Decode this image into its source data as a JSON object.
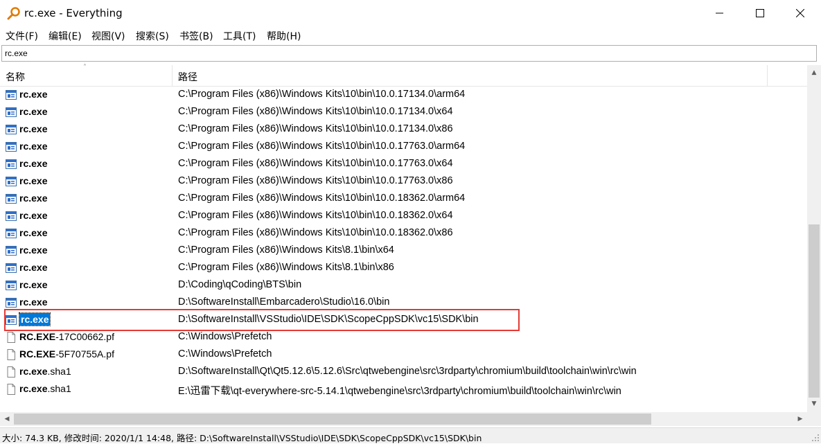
{
  "window": {
    "title": "rc.exe - Everything"
  },
  "menu": [
    {
      "id": "file",
      "label": "文件(F)"
    },
    {
      "id": "edit",
      "label": "编辑(E)"
    },
    {
      "id": "view",
      "label": "视图(V)"
    },
    {
      "id": "search",
      "label": "搜索(S)"
    },
    {
      "id": "bookmarks",
      "label": "书签(B)"
    },
    {
      "id": "tools",
      "label": "工具(T)"
    },
    {
      "id": "help",
      "label": "帮助(H)"
    }
  ],
  "search": {
    "value": "rc.exe"
  },
  "columns": {
    "name": "名称",
    "path": "路径"
  },
  "icons": {
    "exe": "executable-icon",
    "file": "file-icon"
  },
  "rows": [
    {
      "icon": "exe",
      "bold": "rc.exe",
      "rest": "",
      "path": "C:\\Program Files (x86)\\Windows Kits\\10\\bin\\10.0.17134.0\\arm64"
    },
    {
      "icon": "exe",
      "bold": "rc.exe",
      "rest": "",
      "path": "C:\\Program Files (x86)\\Windows Kits\\10\\bin\\10.0.17134.0\\x64"
    },
    {
      "icon": "exe",
      "bold": "rc.exe",
      "rest": "",
      "path": "C:\\Program Files (x86)\\Windows Kits\\10\\bin\\10.0.17134.0\\x86"
    },
    {
      "icon": "exe",
      "bold": "rc.exe",
      "rest": "",
      "path": "C:\\Program Files (x86)\\Windows Kits\\10\\bin\\10.0.17763.0\\arm64"
    },
    {
      "icon": "exe",
      "bold": "rc.exe",
      "rest": "",
      "path": "C:\\Program Files (x86)\\Windows Kits\\10\\bin\\10.0.17763.0\\x64"
    },
    {
      "icon": "exe",
      "bold": "rc.exe",
      "rest": "",
      "path": "C:\\Program Files (x86)\\Windows Kits\\10\\bin\\10.0.17763.0\\x86"
    },
    {
      "icon": "exe",
      "bold": "rc.exe",
      "rest": "",
      "path": "C:\\Program Files (x86)\\Windows Kits\\10\\bin\\10.0.18362.0\\arm64"
    },
    {
      "icon": "exe",
      "bold": "rc.exe",
      "rest": "",
      "path": "C:\\Program Files (x86)\\Windows Kits\\10\\bin\\10.0.18362.0\\x64"
    },
    {
      "icon": "exe",
      "bold": "rc.exe",
      "rest": "",
      "path": "C:\\Program Files (x86)\\Windows Kits\\10\\bin\\10.0.18362.0\\x86"
    },
    {
      "icon": "exe",
      "bold": "rc.exe",
      "rest": "",
      "path": "C:\\Program Files (x86)\\Windows Kits\\8.1\\bin\\x64"
    },
    {
      "icon": "exe",
      "bold": "rc.exe",
      "rest": "",
      "path": "C:\\Program Files (x86)\\Windows Kits\\8.1\\bin\\x86"
    },
    {
      "icon": "exe",
      "bold": "rc.exe",
      "rest": "",
      "path": "D:\\Coding\\qCoding\\BTS\\bin"
    },
    {
      "icon": "exe",
      "bold": "rc.exe",
      "rest": "",
      "path": "D:\\SoftwareInstall\\Embarcadero\\Studio\\16.0\\bin"
    },
    {
      "icon": "exe",
      "bold": "rc.exe",
      "rest": "",
      "path": "D:\\SoftwareInstall\\VSStudio\\IDE\\SDK\\ScopeCppSDK\\vc15\\SDK\\bin",
      "selected": true
    },
    {
      "icon": "file",
      "bold": "RC.EXE",
      "rest": "-17C00662.pf",
      "path": "C:\\Windows\\Prefetch"
    },
    {
      "icon": "file",
      "bold": "RC.EXE",
      "rest": "-5F70755A.pf",
      "path": "C:\\Windows\\Prefetch"
    },
    {
      "icon": "file",
      "bold": "rc.exe",
      "rest": ".sha1",
      "path": "D:\\SoftwareInstall\\Qt\\Qt5.12.6\\5.12.6\\Src\\qtwebengine\\src\\3rdparty\\chromium\\build\\toolchain\\win\\rc\\win"
    },
    {
      "icon": "file",
      "bold": "rc.exe",
      "rest": ".sha1",
      "path": "E:\\迅雷下载\\qt-everywhere-src-5.14.1\\qtwebengine\\src\\3rdparty\\chromium\\build\\toolchain\\win\\rc\\win"
    }
  ],
  "status": {
    "text": "大小: 74.3 KB, 修改时间: 2020/1/1 14:48, 路径: D:\\SoftwareInstall\\VSStudio\\IDE\\SDK\\ScopeCppSDK\\vc15\\SDK\\bin"
  },
  "colors": {
    "selection": "#0078d7",
    "highlight": "#e53935"
  }
}
